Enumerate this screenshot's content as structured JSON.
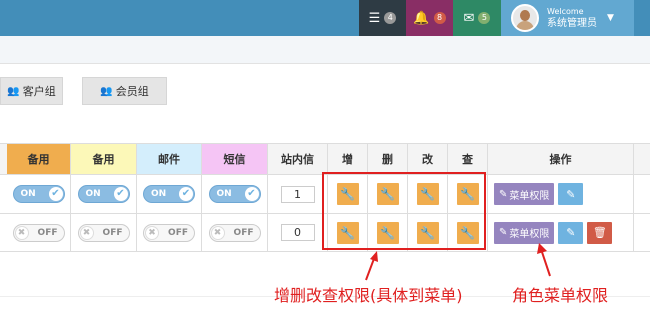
{
  "navbar": {
    "tasks_badge": "4",
    "notifications_badge": "8",
    "messages_badge": "5",
    "user_greeting": "Welcome",
    "user_name": "系统管理员"
  },
  "tabs": [
    {
      "label": "客户组"
    },
    {
      "label": "会员组"
    }
  ],
  "table": {
    "headers": [
      "备用",
      "备用",
      "邮件",
      "短信",
      "站内信",
      "增",
      "删",
      "改",
      "查",
      "操作"
    ],
    "header_colors": [
      "#f0ad4e",
      "#fcf8b8",
      "#d4eefc",
      "#f5c5f5",
      "#f4f4f4"
    ],
    "rows": [
      {
        "switches": [
          "ON",
          "ON",
          "ON",
          "ON"
        ],
        "count": "1",
        "actions": [
          "菜单权限"
        ],
        "has_delete": false
      },
      {
        "switches": [
          "OFF",
          "OFF",
          "OFF",
          "OFF"
        ],
        "count": "0",
        "actions": [
          "菜单权限"
        ],
        "has_delete": true
      }
    ]
  },
  "annotations": {
    "crud": "增删改查权限(具体到菜单)",
    "role_menu": "角色菜单权限"
  }
}
